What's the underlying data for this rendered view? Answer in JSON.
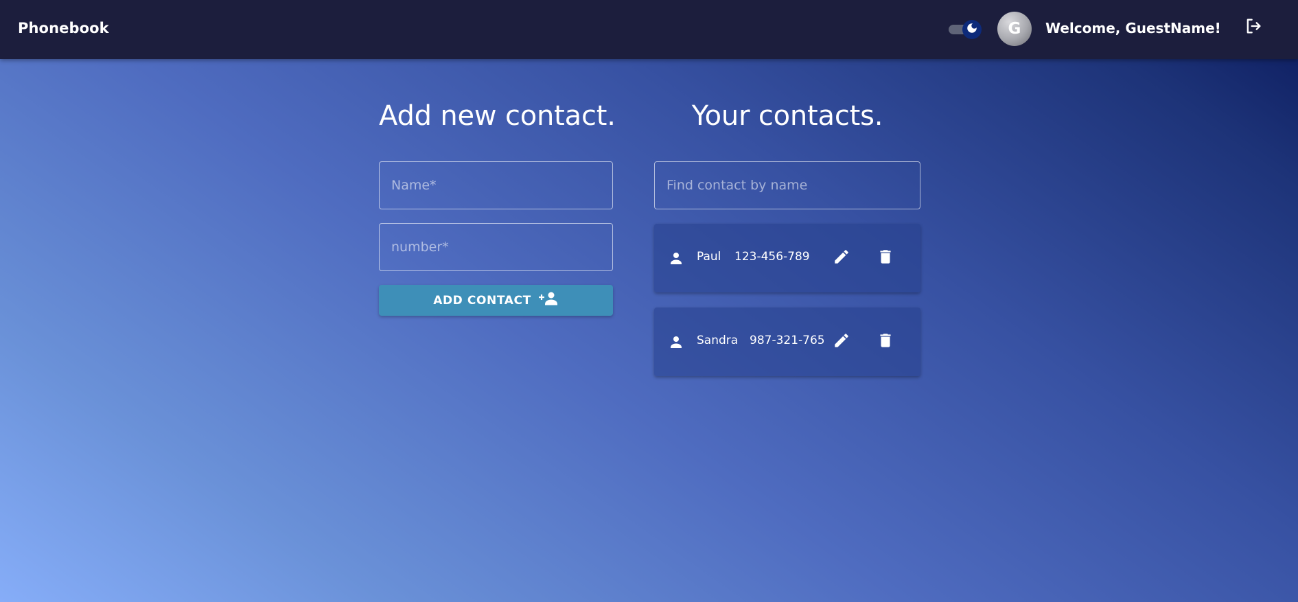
{
  "header": {
    "brand": "Phonebook",
    "avatar_initial": "G",
    "welcome": "Welcome, GuestName!",
    "theme_toggle_icon": "moon-icon",
    "logout_icon": "logout-icon",
    "background": "#1c1e3d"
  },
  "add_form": {
    "title": "Add new contact.",
    "name_placeholder": "Name*",
    "number_placeholder": "number*",
    "button_label": "ADD CONTACT",
    "button_icon": "person-add-icon",
    "button_color": "#3e8fb8"
  },
  "contacts": {
    "title": "Your contacts.",
    "search_placeholder": "Find contact by name",
    "items": [
      {
        "name": "Paul",
        "number": "123-456-789",
        "icon": "person-icon",
        "edit_icon": "pencil-icon",
        "delete_icon": "trash-icon"
      },
      {
        "name": "Sandra",
        "number": "987-321-765",
        "icon": "person-icon",
        "edit_icon": "pencil-icon",
        "delete_icon": "trash-icon"
      }
    ]
  }
}
